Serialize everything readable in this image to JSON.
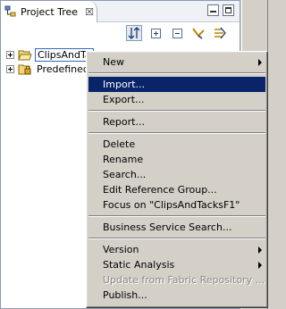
{
  "view": {
    "tab_title": "Project Tree",
    "tab_close": "☒",
    "toolbar": [
      {
        "name": "link-with-editor-icon"
      },
      {
        "name": "expand-all-icon"
      },
      {
        "name": "collapse-all-icon"
      },
      {
        "name": "filter-icon"
      },
      {
        "name": "view-menu-icon"
      }
    ]
  },
  "tree": {
    "items": [
      {
        "label": "ClipsAndTacksF1",
        "visible_label": "ClipsAndTa",
        "selected": true,
        "icon": "open-folder-icon"
      },
      {
        "label": "Predefined",
        "visible_label": "Predefined",
        "selected": false,
        "icon": "locked-folder-icon"
      }
    ]
  },
  "context_menu": {
    "items": [
      {
        "label": "New",
        "submenu": true
      },
      {
        "separator": true
      },
      {
        "label": "Import...",
        "highlighted": true
      },
      {
        "label": "Export..."
      },
      {
        "separator": true
      },
      {
        "label": "Report..."
      },
      {
        "separator": true
      },
      {
        "label": "Delete"
      },
      {
        "label": "Rename"
      },
      {
        "label": "Search..."
      },
      {
        "label": "Edit Reference Group..."
      },
      {
        "label": "Focus on \"ClipsAndTacksF1\""
      },
      {
        "separator": true
      },
      {
        "label": "Business Service Search..."
      },
      {
        "separator": true
      },
      {
        "label": "Version",
        "submenu": true
      },
      {
        "label": "Static Analysis",
        "submenu": true
      },
      {
        "label": "Update from Fabric Repository ...",
        "disabled": true
      },
      {
        "label": "Publish..."
      }
    ]
  },
  "colors": {
    "highlight": "#0a246a",
    "menu_bg": "#d4d0c8",
    "disabled_text": "#8d8a84"
  }
}
